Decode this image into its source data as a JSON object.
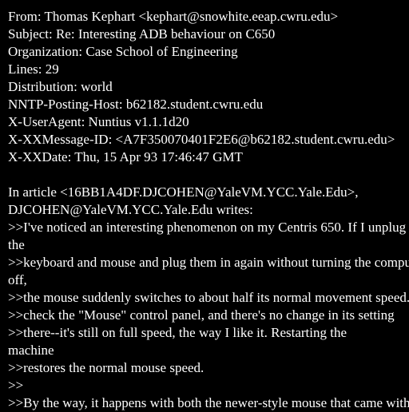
{
  "colors": {
    "background": "#000000",
    "text": "#ffffff"
  },
  "header": {
    "from": "From: Thomas Kephart <kephart@snowhite.eeap.cwru.edu>",
    "subject": "Subject: Re: Interesting ADB behaviour on C650",
    "organization": "Organization: Case School of Engineering",
    "lines": "Lines: 29",
    "distribution": "Distribution: world",
    "posting_host": "NNTP-Posting-Host: b62182.student.cwru.edu",
    "user_agent": "X-UserAgent: Nuntius v1.1.1d20",
    "message_id": "X-XXMessage-ID: <A7F350070401F2E6@b62182.student.cwru.edu>",
    "date": "X-XXDate: Thu, 15 Apr 93 17:46:47 GMT"
  },
  "body": {
    "lines": [
      "In article <16BB1A4DF.DJCOHEN@YaleVM.YCC.Yale.Edu>,",
      "DJCOHEN@YaleVM.YCC.Yale.Edu writes:",
      ">>I've noticed an interesting phenomenon on my Centris 650. If I unplug",
      "the",
      ">>keyboard and mouse and plug them in again without turning the computer",
      "off,",
      ">>the mouse suddenly switches to about half its normal movement speed. I",
      ">>check the \"Mouse\" control panel, and there's no change in its setting",
      ">>there--it's still on full speed, the way I like it. Restarting the",
      "machine",
      ">>restores the normal mouse speed.",
      ">>",
      ">>By the way, it happens with both the newer-style mouse that came with"
    ]
  }
}
